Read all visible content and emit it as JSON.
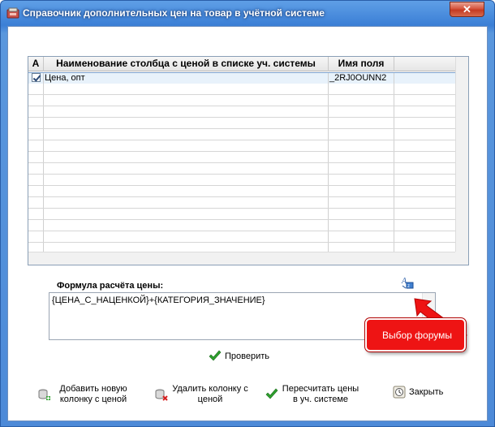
{
  "window": {
    "title": "Справочник дополнительных цен на товар в учётной системе",
    "close_label": "✕"
  },
  "grid": {
    "headers": [
      "A",
      "Наименование столбца с ценой в списке уч. системы",
      "Имя поля",
      ""
    ],
    "rows": [
      {
        "checked": true,
        "name": "Цена, опт",
        "field": "_2RJ0OUNN2"
      }
    ],
    "empty_rows": 15
  },
  "formula": {
    "label": "Формула расчёта цены:",
    "value": "{ЦЕНА_С_НАЦЕНКОЙ}+{КАТЕГОРИЯ_ЗНАЧЕНИЕ}"
  },
  "buttons": {
    "check": "Проверить",
    "add_column": "Добавить новую колонку с ценой",
    "delete_column": "Удалить колонку с ценой",
    "recalc": "Пересчитать цены в уч. системе",
    "close": "Закрыть"
  },
  "callout": {
    "text": "Выбор форумы"
  },
  "colors": {
    "titlebar": "#3b7fd6",
    "callout": "#ee1414",
    "check_green": "#2ea12e"
  }
}
